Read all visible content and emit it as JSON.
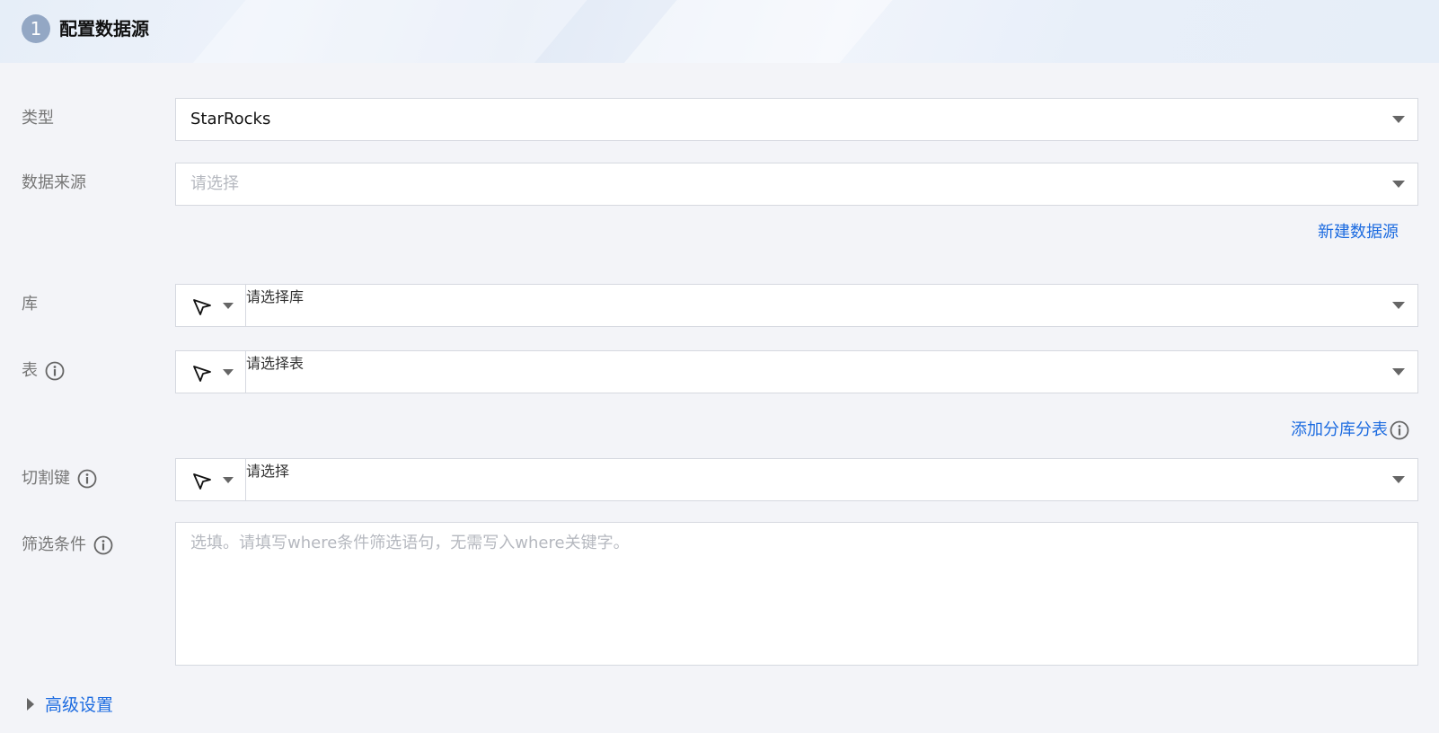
{
  "header": {
    "step_number": "1",
    "title": "配置数据源"
  },
  "form": {
    "type": {
      "label": "类型",
      "value": "StarRocks"
    },
    "datasource": {
      "label": "数据来源",
      "placeholder": "请选择",
      "new_link": "新建数据源"
    },
    "database": {
      "label": "库",
      "placeholder": "请选择库"
    },
    "table": {
      "label": "表",
      "placeholder": "请选择表",
      "add_link": "添加分库分表"
    },
    "split_key": {
      "label": "切割键",
      "placeholder": "请选择"
    },
    "filter": {
      "label": "筛选条件",
      "placeholder": "选填。请填写where条件筛选语句，无需写入where关键字。"
    }
  },
  "advanced": {
    "label": "高级设置"
  },
  "colors": {
    "link": "#1c6be0",
    "step_badge": "#93a7c4"
  }
}
